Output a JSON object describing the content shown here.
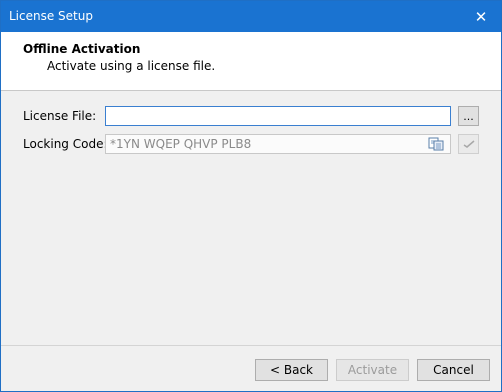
{
  "window": {
    "title": "License Setup"
  },
  "header": {
    "title": "Offline Activation",
    "subtitle": "Activate using a license file."
  },
  "form": {
    "license_file": {
      "label": "License File:",
      "value": ""
    },
    "browse_label": "...",
    "locking_code": {
      "label": "Locking Code:",
      "value": "*1YN WQEP QHVP PLB8"
    }
  },
  "buttons": {
    "back": "< Back",
    "activate": "Activate",
    "cancel": "Cancel"
  },
  "colors": {
    "titlebar": "#1a73d1",
    "focus_border": "#3a7fd0"
  },
  "icons": {
    "close": "close-icon",
    "copy": "copy-icon",
    "apply": "checkmark-icon"
  }
}
